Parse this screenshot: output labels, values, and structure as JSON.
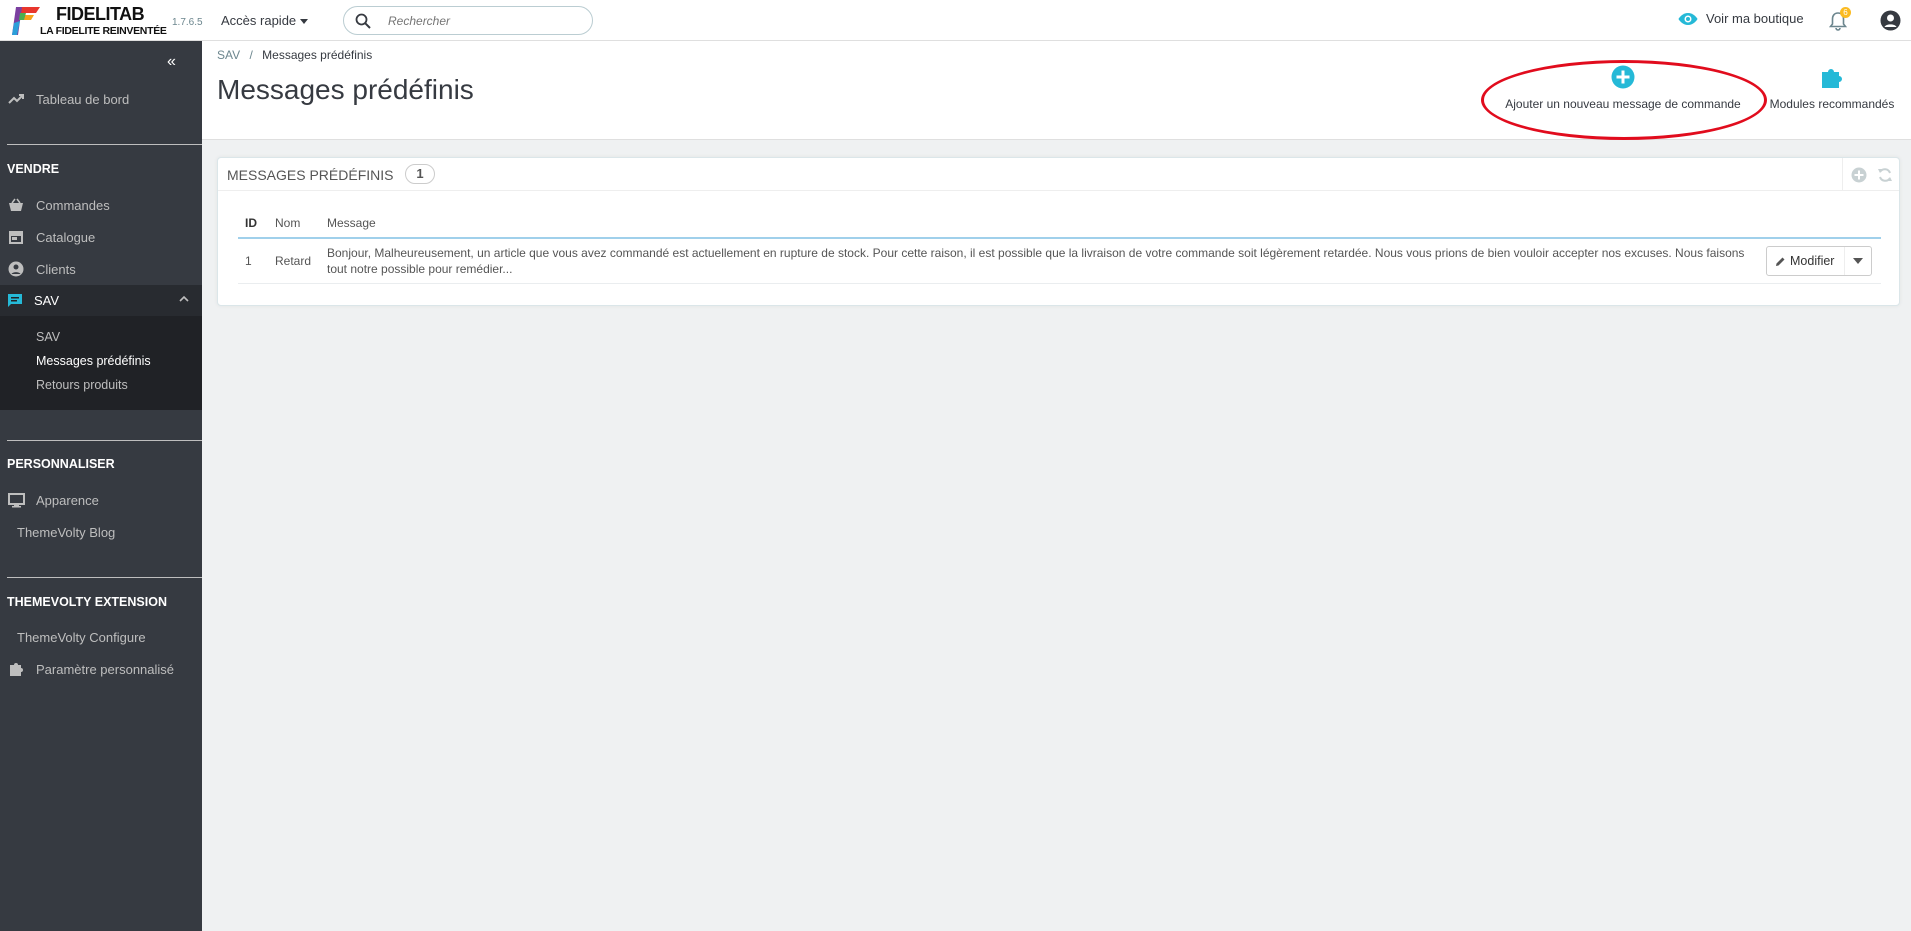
{
  "header": {
    "brand_name": "FIDELITAB",
    "brand_tagline": "LA FIDELITE REINVENTÉE",
    "version": "1.7.6.5",
    "quick_access_label": "Accès rapide",
    "search_placeholder": "Rechercher",
    "view_shop_label": "Voir ma boutique",
    "notification_count": "6"
  },
  "sidebar": {
    "dashboard": "Tableau de bord",
    "sell_section": "VENDRE",
    "orders": "Commandes",
    "catalog": "Catalogue",
    "customers": "Clients",
    "sav": "SAV",
    "sav_sub": [
      "SAV",
      "Messages prédéfinis",
      "Retours produits"
    ],
    "customize_section": "PERSONNALISER",
    "appearance": "Apparence",
    "blog": "ThemeVolty Blog",
    "extension_section": "THEMEVOLTY EXTENSION",
    "tv_configure": "ThemeVolty Configure",
    "custom_param": "Paramètre personnalisé"
  },
  "pagehead": {
    "breadcrumb_parent": "SAV",
    "breadcrumb_sep": "/",
    "breadcrumb_current": "Messages prédéfinis",
    "title": "Messages prédéfinis",
    "add_button": "Ajouter un nouveau message de commande",
    "modules_button": "Modules recommandés"
  },
  "panel": {
    "title": "MESSAGES PRÉDÉFINIS",
    "count": "1",
    "columns": [
      "ID",
      "Nom",
      "Message"
    ],
    "rows": [
      {
        "id": "1",
        "name": "Retard",
        "message": "Bonjour, Malheureusement, un article que vous avez commandé est actuellement en rupture de stock. Pour cette raison, il est possible que la livraison de votre commande soit légèrement retardée. Nous vous prions de bien vouloir accepter nos excuses. Nous faisons tout notre possible pour remédier...",
        "action": "Modifier"
      }
    ]
  },
  "colors": {
    "accent": "#25b9d7",
    "sidebar_bg": "#363a41",
    "highlight_ellipse": "#e10c1d",
    "badge": "#fbbb22"
  }
}
